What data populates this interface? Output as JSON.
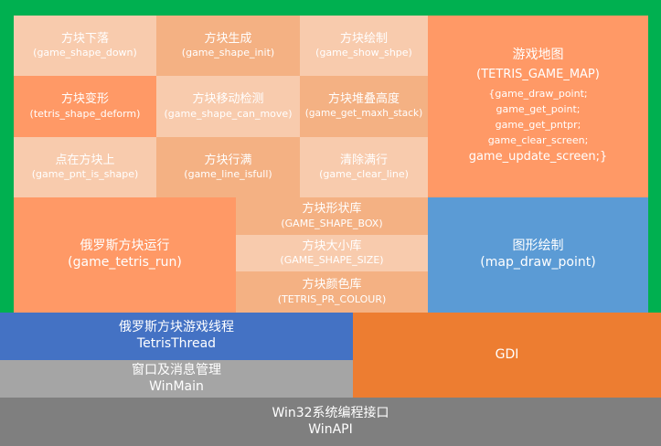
{
  "modules": {
    "shape_down": {
      "zh": "方块下落",
      "fn": "(game_shape_down)"
    },
    "shape_init": {
      "zh": "方块生成",
      "fn": "(game_shape_init)"
    },
    "show_shape": {
      "zh": "方块绘制",
      "fn": "(game_show_shpe)"
    },
    "shape_deform": {
      "zh": "方块变形",
      "fn": "(tetris_shape_deform)"
    },
    "can_move": {
      "zh": "方块移动检测",
      "fn": "(game_shape_can_move)"
    },
    "maxh_stack": {
      "zh": "方块堆叠高度",
      "fn": "(game_get_maxh_stack)"
    },
    "pnt_is_shape": {
      "zh": "点在方块上",
      "fn": "(game_pnt_is_shape)"
    },
    "line_isfull": {
      "zh": "方块行满",
      "fn": "(game_line_isfull)"
    },
    "clear_line": {
      "zh": "清除满行",
      "fn": "(game_clear_line)"
    }
  },
  "game_map": {
    "zh": "游戏地图",
    "name": "(TETRIS_GAME_MAP)",
    "functions": [
      "{game_draw_point;",
      "game_get_point;",
      "game_get_pntpr;",
      "game_clear_screen;",
      "game_update_screen;}"
    ]
  },
  "tetris_run": {
    "zh": "俄罗斯方块运行",
    "fn": "(game_tetris_run)"
  },
  "shape_box": {
    "zh": "方块形状库",
    "name": "(GAME_SHAPE_BOX)"
  },
  "shape_size": {
    "zh": "方块大小库",
    "name": "(GAME_SHAPE_SIZE)"
  },
  "pr_colour": {
    "zh": "方块颜色库",
    "name": "(TETRIS_PR_COLOUR)"
  },
  "map_draw": {
    "zh": "图形绘制",
    "fn": "(map_draw_point)"
  },
  "thread": {
    "zh": "俄罗斯方块游戏线程",
    "name": "TetrisThread"
  },
  "gdi": {
    "label": "GDI"
  },
  "winmain": {
    "zh": "窗口及消息管理",
    "name": "WinMain"
  },
  "winapi": {
    "zh": "Win32系统编程接口",
    "name": "WinAPI"
  },
  "colors": {
    "frame_green": "#00b050",
    "light_peach": "#f8cbad",
    "mid_peach": "#f4b183",
    "orange": "#ff9966",
    "blue": "#5b9bd5",
    "navy": "#4472c4",
    "gdi_orange": "#ed7d31",
    "grey": "#a5a5a5",
    "dark_grey": "#7f7f7f"
  }
}
